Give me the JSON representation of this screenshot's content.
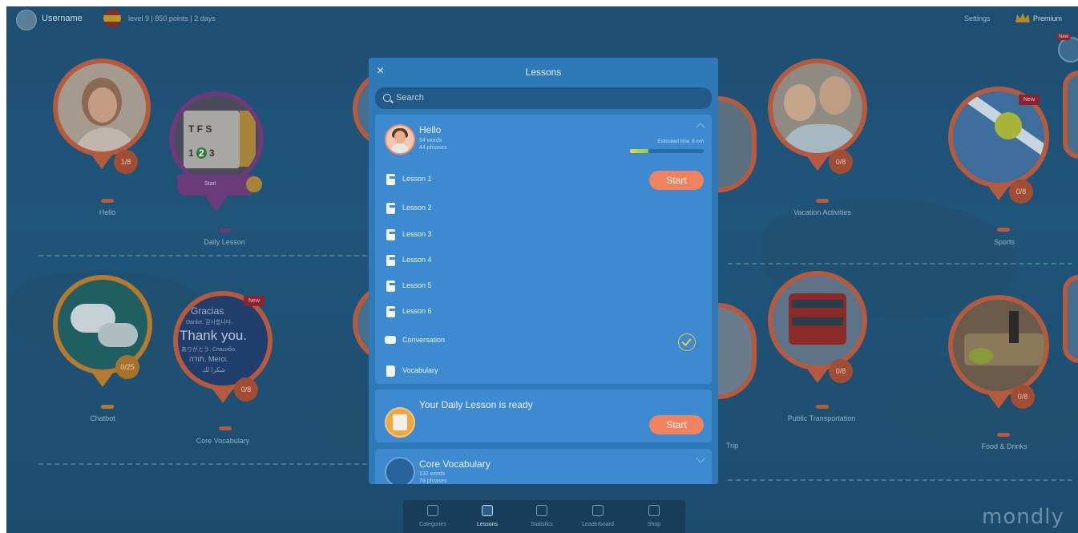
{
  "topbar": {
    "username": "Username",
    "stats": "level 9 | 850 points | 2 days",
    "settings_label": "Settings",
    "premium_label": "Premium",
    "corner_badge": "New"
  },
  "pins": {
    "hello": {
      "label": "Hello",
      "count": "1/8"
    },
    "daily_lesson": {
      "label": "Daily Lesson",
      "start": "Start"
    },
    "chatbot": {
      "label": "Chatbot",
      "count": "0/25"
    },
    "core_vocabulary": {
      "label": "Core Vocabulary",
      "count": "0/8",
      "new_tag": "New"
    },
    "vacation": {
      "label": "Vacation Activities",
      "count": "0/8"
    },
    "sports": {
      "label": "Sports",
      "count": "0/8",
      "new_tag": "New"
    },
    "transport": {
      "label": "Public Transportation",
      "count": "0/8"
    },
    "food": {
      "label": "Food & Drinks",
      "count": "0/8"
    },
    "trip": {
      "label": "Trip"
    }
  },
  "thank_you_text": {
    "line1": "Gracias",
    "line2": "Danke. 감사합니다.",
    "line3": "Thank you.",
    "line4": "ありがとう. Спасибо.",
    "line5": "תודה. Merci.",
    "line6": "شكرا لك"
  },
  "modal": {
    "close": "×",
    "title": "Lessons",
    "search_placeholder": "Search",
    "hello_card": {
      "title": "Hello",
      "words": "54 words",
      "phrases": "44 phrases",
      "estimated": "Estimated time: 8 min",
      "progress": 0.25,
      "rows": [
        {
          "label": "Lesson 1"
        },
        {
          "label": "Lesson 2"
        },
        {
          "label": "Lesson 3"
        },
        {
          "label": "Lesson 4"
        },
        {
          "label": "Lesson 5"
        },
        {
          "label": "Lesson 6"
        },
        {
          "label": "Conversation"
        },
        {
          "label": "Vocabulary"
        }
      ],
      "start_label": "Start"
    },
    "daily_card": {
      "title": "Your Daily Lesson is ready",
      "start_label": "Start"
    },
    "core_card": {
      "title": "Core Vocabulary",
      "words": "132 words",
      "phrases": "78 phrases"
    }
  },
  "bottom_nav": {
    "items": [
      {
        "label": "Categories"
      },
      {
        "label": "Lessons"
      },
      {
        "label": "Statistics"
      },
      {
        "label": "Leaderboard"
      },
      {
        "label": "Shop"
      }
    ],
    "active": "Lessons"
  },
  "brand": {
    "logo": "mondly"
  },
  "colors": {
    "accent": "#f0835f",
    "modal_bg": "#2f79b8",
    "card_bg": "#3d8ad0",
    "pin_border": "#b55a3e"
  }
}
